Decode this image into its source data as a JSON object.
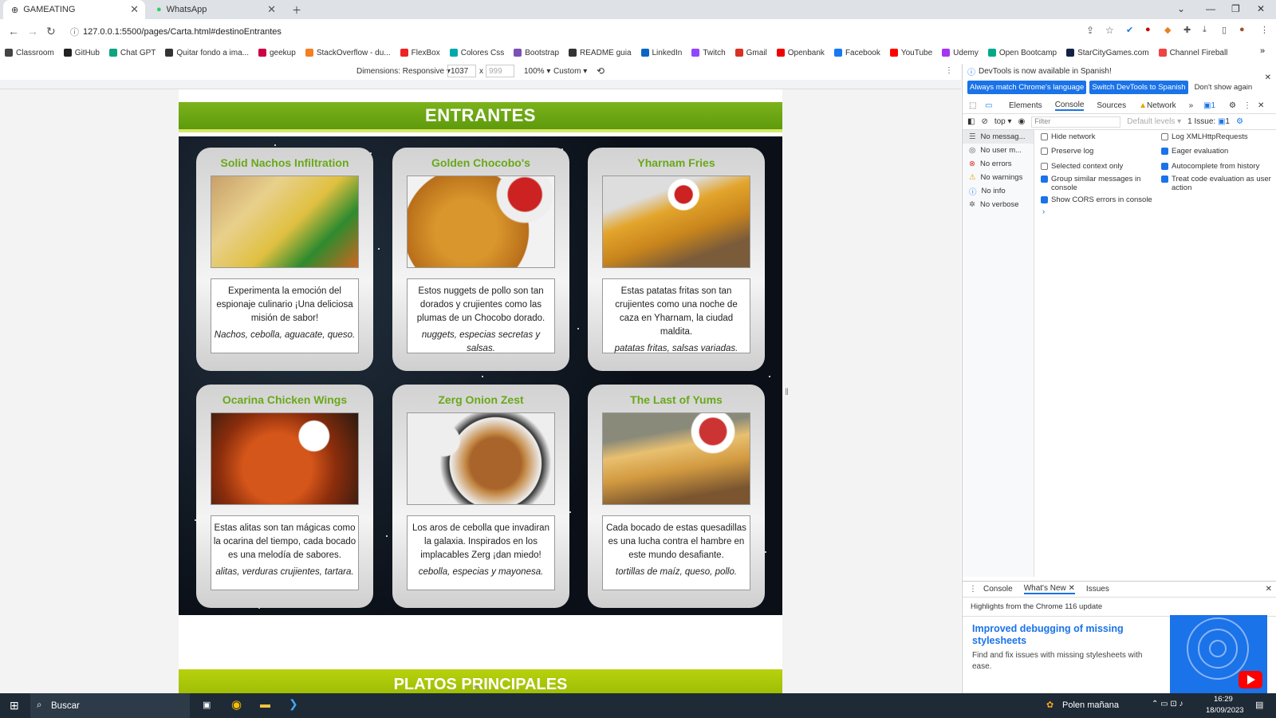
{
  "browser": {
    "tabs": [
      {
        "title": "GAMEATING"
      },
      {
        "title": "WhatsApp"
      }
    ],
    "url": "127.0.0.1:5500/pages/Carta.html#destinoEntrantes",
    "bookmarks": [
      "Classroom",
      "GitHub",
      "Chat GPT",
      "Quitar fondo a ima...",
      "geekup",
      "StackOverflow - du...",
      "FlexBox",
      "Colores Css",
      "Bootstrap",
      "README guia",
      "LinkedIn",
      "Twitch",
      "Gmail",
      "Openbank",
      "Facebook",
      "YouTube",
      "Udemy",
      "Open Bootcamp",
      "StarCityGames.com",
      "Channel Fireball"
    ]
  },
  "device_toolbar": {
    "dimensions_label": "Dimensions: Responsive",
    "width": "1037",
    "height_placeholder": "999",
    "x": "x",
    "zoom": "100%",
    "throttle": "Custom"
  },
  "page": {
    "section_title": "ENTRANTES",
    "next_section": "PLATOS PRINCIPALES",
    "cards": [
      {
        "title": "Solid Nachos Infiltration",
        "desc": "Experimenta la emoción del espionaje culinario ¡Una deliciosa misión de sabor!",
        "ingredients": "Nachos, cebolla, aguacate, queso."
      },
      {
        "title": "Golden Chocobo's",
        "desc": "Estos nuggets de pollo son tan dorados y crujientes como las plumas de un Chocobo dorado.",
        "ingredients": "nuggets, especias secretas y salsas."
      },
      {
        "title": "Yharnam Fries",
        "desc": "Estas patatas fritas son tan crujientes como una noche de caza en Yharnam, la ciudad maldita.",
        "ingredients": "patatas fritas, salsas variadas."
      },
      {
        "title": "Ocarina Chicken Wings",
        "desc": "Estas alitas son tan mágicas como la ocarina del tiempo, cada bocado es una melodía de sabores.",
        "ingredients": "alitas, verduras crujientes, tartara."
      },
      {
        "title": "Zerg Onion Zest",
        "desc": "Los aros de cebolla que invadiran la galaxia. Inspirados en los implacables Zerg ¡dan miedo!",
        "ingredients": "cebolla, especias y mayonesa."
      },
      {
        "title": "The Last of Yums",
        "desc": "Cada bocado de estas quesadillas es una lucha contra el hambre en este mundo desafiante.",
        "ingredients": "tortillas de maíz, queso, pollo."
      }
    ]
  },
  "devtools": {
    "notice": "DevTools is now available in Spanish!",
    "btn_match": "Always match Chrome's language",
    "btn_switch": "Switch DevTools to Spanish",
    "btn_dont": "Don't show again",
    "tabs": [
      "Elements",
      "Console",
      "Sources",
      "Network"
    ],
    "issues_count": "1",
    "context": "top",
    "filter_placeholder": "Filter",
    "levels": "Default levels",
    "issues_label": "1 Issue:",
    "sidebar": [
      "No messag...",
      "No user m...",
      "No errors",
      "No warnings",
      "No info",
      "No verbose"
    ],
    "options_left": [
      {
        "label": "Hide network",
        "checked": false
      },
      {
        "label": "Preserve log",
        "checked": false
      },
      {
        "label": "Selected context only",
        "checked": false
      },
      {
        "label": "Group similar messages in console",
        "checked": true
      },
      {
        "label": "Show CORS errors in console",
        "checked": true
      }
    ],
    "options_right": [
      {
        "label": "Log XMLHttpRequests",
        "checked": false
      },
      {
        "label": "Eager evaluation",
        "checked": true
      },
      {
        "label": "Autocomplete from history",
        "checked": true
      },
      {
        "label": "Treat code evaluation as user action",
        "checked": true
      }
    ],
    "drawer_tabs": [
      "Console",
      "What's New",
      "Issues"
    ],
    "highlights": "Highlights from the Chrome 116 update",
    "article_title": "Improved debugging of missing stylesheets",
    "article_body": "Find and fix issues with missing stylesheets with ease."
  },
  "taskbar": {
    "search": "Buscar",
    "weather": "Polen mañana",
    "time": "16:29",
    "date": "18/09/2023"
  }
}
